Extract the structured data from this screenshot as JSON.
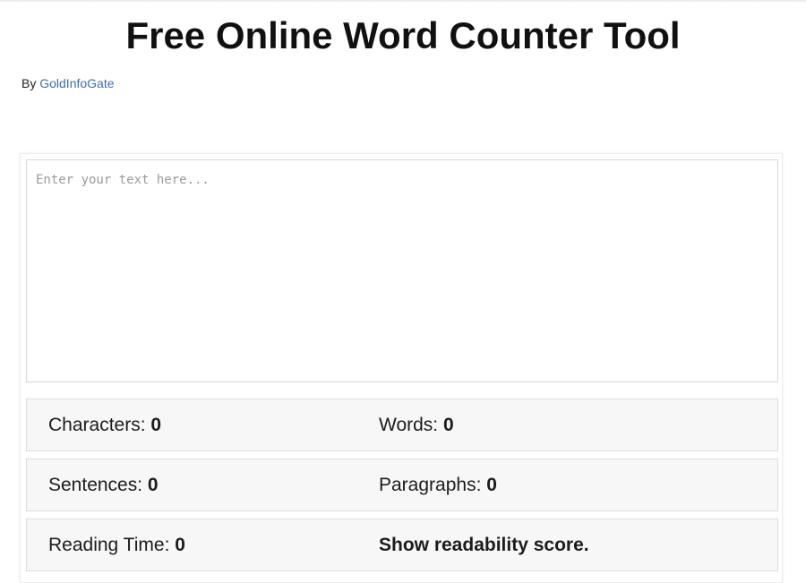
{
  "header": {
    "title": "Free Online Word Counter Tool",
    "byline_prefix": "By",
    "author": "GoldInfoGate"
  },
  "editor": {
    "placeholder": "Enter your text here...",
    "value": ""
  },
  "stats": {
    "characters": {
      "label": "Characters:",
      "value": "0"
    },
    "words": {
      "label": "Words:",
      "value": "0"
    },
    "sentences": {
      "label": "Sentences:",
      "value": "0"
    },
    "paragraphs": {
      "label": "Paragraphs:",
      "value": "0"
    },
    "reading_time": {
      "label": "Reading Time:",
      "value": "0"
    },
    "readability_link": "Show readability score."
  },
  "colors": {
    "link": "#3b6fb6",
    "stat_background": "#f7f7f7",
    "border": "#dcdcdc"
  }
}
